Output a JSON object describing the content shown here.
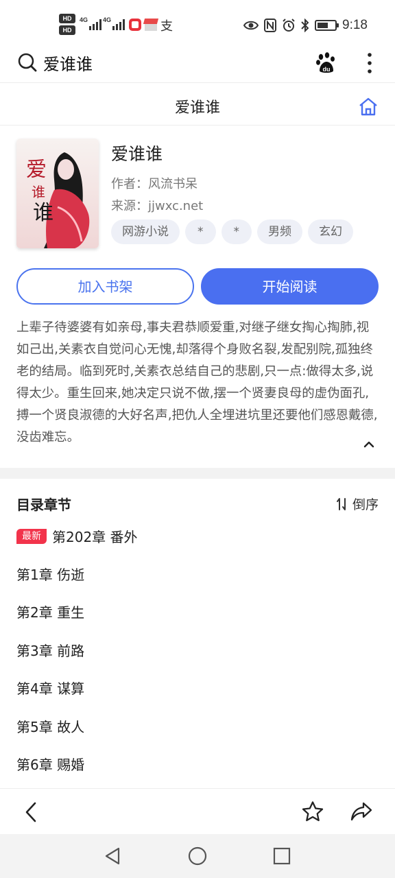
{
  "status_bar": {
    "hd_labels": [
      "HD",
      "HD"
    ],
    "network_1": "4G",
    "network_2": "4G",
    "time": "9:18"
  },
  "search": {
    "query": "爱谁谁"
  },
  "header": {
    "title": "爱谁谁"
  },
  "book": {
    "title": "爱谁谁",
    "author_label": "作者：",
    "author": "风流书呆",
    "source_label": "来源：",
    "source": "jjwxc.net",
    "tags": [
      "网游小说",
      "*",
      "*",
      "男频",
      "玄幻"
    ]
  },
  "buttons": {
    "add_shelf": "加入书架",
    "start_reading": "开始阅读"
  },
  "description": "上辈子待婆婆有如亲母,事夫君恭顺爱重,对继子继女掏心掏肺,视如己出,关素衣自觉问心无愧,却落得个身败名裂,发配别院,孤独终老的结局。临到死时,关素衣总结自己的悲剧,只一点:做得太多,说得太少。重生回来,她决定只说不做,摆一个贤妻良母的虚伪面孔,搏一个贤良淑德的大好名声,把仇人全埋进坑里还要他们感恩戴德,没齿难忘。",
  "catalog": {
    "title": "目录章节",
    "sort_label": "倒序",
    "new_badge": "最新",
    "latest_chapter": "第202章 番外",
    "chapters": [
      "第1章 伤逝",
      "第2章 重生",
      "第3章 前路",
      "第4章 谋算",
      "第5章 故人",
      "第6章 赐婚"
    ]
  },
  "colors": {
    "accent": "#4a6ff0",
    "badge": "#f2334b"
  }
}
